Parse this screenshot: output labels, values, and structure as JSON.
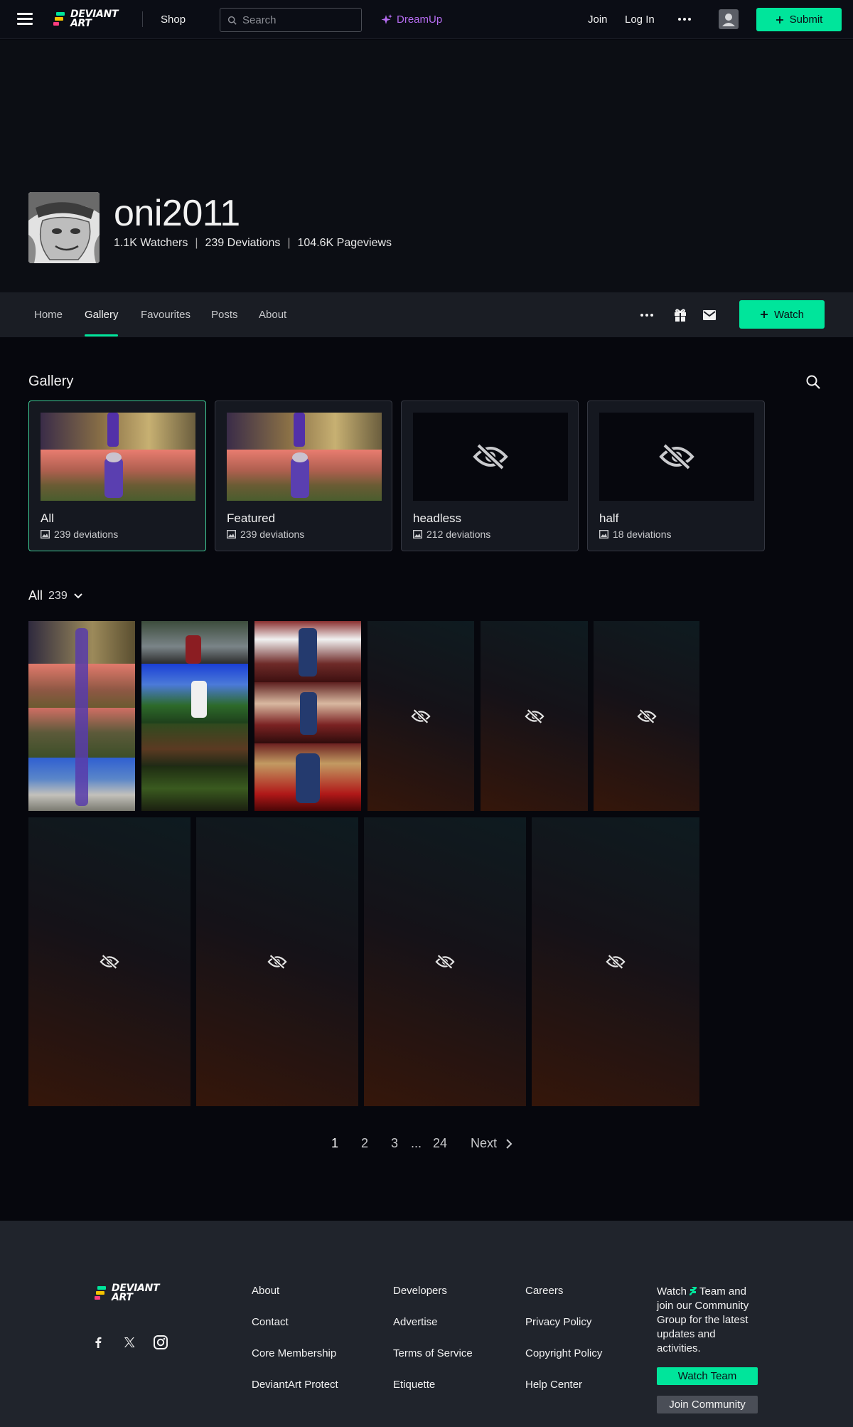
{
  "topbar": {
    "logo_line1": "DEVIANT",
    "logo_line2": "ART",
    "shop_label": "Shop",
    "search_placeholder": "Search",
    "dreamup_label": "DreamUp",
    "join_label": "Join",
    "login_label": "Log In",
    "submit_label": "Submit"
  },
  "profile": {
    "username": "oni2011",
    "watchers": "1.1K Watchers",
    "deviations": "239 Deviations",
    "pageviews": "104.6K Pageviews",
    "stat_separator": "|"
  },
  "profile_nav": {
    "tabs": [
      "Home",
      "Gallery",
      "Favourites",
      "Posts",
      "About"
    ],
    "active_tab": "Gallery",
    "watch_label": "Watch"
  },
  "gallery": {
    "title": "Gallery",
    "folders": [
      {
        "name": "All",
        "count": "239 deviations"
      },
      {
        "name": "Featured",
        "count": "239 deviations"
      },
      {
        "name": "headless",
        "count": "212 deviations"
      },
      {
        "name": "half",
        "count": "18 deviations"
      }
    ],
    "filter_label": "All",
    "filter_count": "239"
  },
  "pagination": {
    "pages": [
      "1",
      "2",
      "3",
      "24"
    ],
    "ellipsis": "...",
    "current": "1",
    "next_label": "Next"
  },
  "footer": {
    "logo_line1": "DEVIANT",
    "logo_line2": "ART",
    "col1": [
      "About",
      "Contact",
      "Core Membership",
      "DeviantArt Protect"
    ],
    "col2": [
      "Developers",
      "Advertise",
      "Terms of Service",
      "Etiquette"
    ],
    "col3": [
      "Careers",
      "Privacy Policy",
      "Copyright Policy",
      "Help Center"
    ],
    "cta_watch": "Watch",
    "cta_rest": "Team and join our Community Group for the latest updates and activities.",
    "watch_team_label": "Watch Team",
    "join_community_label": "Join Community"
  },
  "colors": {
    "accent": "#00e59b",
    "dreamup": "#b56cf0",
    "background": "#06070d"
  },
  "icons": [
    "menu-icon",
    "search-icon",
    "sparkle-icon",
    "more-icon",
    "user-icon",
    "plus-icon",
    "gift-icon",
    "mail-icon",
    "eye-off-icon",
    "image-icon",
    "chevron-down-icon",
    "chevron-right-icon",
    "facebook-icon",
    "x-icon",
    "instagram-icon"
  ]
}
